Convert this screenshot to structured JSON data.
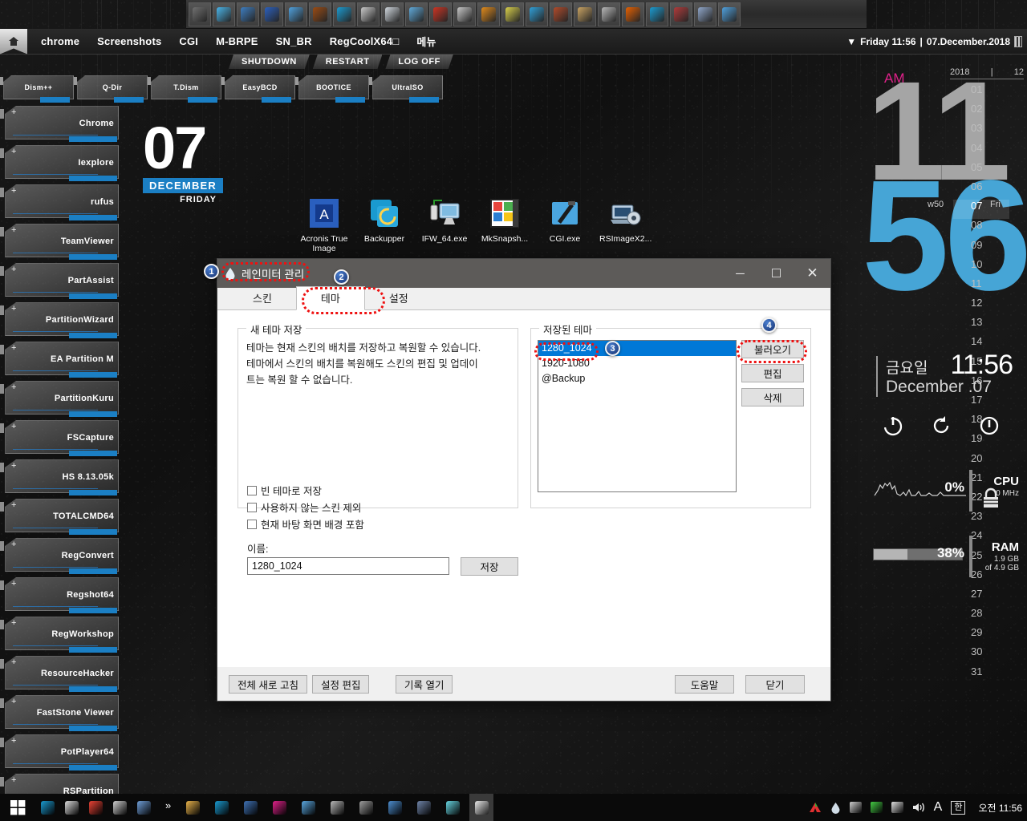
{
  "top_strip": {
    "icons": [
      {
        "name": "windows-logo-icon",
        "color": "#6f6f6f"
      },
      {
        "name": "triangle-app-icon",
        "color": "#49b3e8"
      },
      {
        "name": "blue-doc-icon",
        "color": "#3d7dc0"
      },
      {
        "name": "acronis-a-icon",
        "color": "#2a5fbe"
      },
      {
        "name": "blue-node-icon",
        "color": "#4fa0dd"
      },
      {
        "name": "bridge-br-icon",
        "color": "#9a4a12"
      },
      {
        "name": "backupper-icon",
        "color": "#1a9ad0"
      },
      {
        "name": "drive-icon",
        "color": "#c9c9c9"
      },
      {
        "name": "clock-icon",
        "color": "#cfd6dd"
      },
      {
        "name": "wand-icon",
        "color": "#5fa8d8"
      },
      {
        "name": "g-red-icon",
        "color": "#cc3322"
      },
      {
        "name": "book-icon",
        "color": "#c6c6c6"
      },
      {
        "name": "orange-disc-icon",
        "color": "#e08a1b"
      },
      {
        "name": "scissors-icon",
        "color": "#d8cf4a"
      },
      {
        "name": "gear-icon",
        "color": "#2f9fd8"
      },
      {
        "name": "supra-recorder-icon",
        "color": "#b04a2a"
      },
      {
        "name": "jar-icon",
        "color": "#c8a262"
      },
      {
        "name": "usb-stick-icon",
        "color": "#b8b8b8"
      },
      {
        "name": "firefox-icon",
        "color": "#e66000"
      },
      {
        "name": "edge-icon",
        "color": "#1a9ad0"
      },
      {
        "name": "rs-script-icon",
        "color": "#b03a3a"
      },
      {
        "name": "tower-icon",
        "color": "#8fa5c8"
      },
      {
        "name": "paint-icon",
        "color": "#4fa0dd"
      }
    ]
  },
  "menubar": {
    "home_icon": "home-icon",
    "items": [
      "chrome",
      "Screenshots",
      "CGI",
      "M-BRPE",
      "SN_BR",
      "RegCoolX64□",
      "메뉴"
    ],
    "clock_caret": "▼",
    "clock_text": "Friday 11:56",
    "separator": "|",
    "date_text": "07.December.2018",
    "calendar_icon": "calendar-icon"
  },
  "power_row": [
    "SHUTDOWN",
    "RESTART",
    "LOG OFF"
  ],
  "top_tiles": [
    "Dism++",
    "Q-Dir",
    "T.Dism",
    "EasyBCD",
    "BOOTICE",
    "UltraISO"
  ],
  "side_tiles": [
    "Chrome",
    "Iexplore",
    "rufus",
    "TeamViewer",
    "PartAssist",
    "PartitionWizard",
    "EA Partition M",
    "PartitionKuru",
    "FSCapture",
    "HS 8.13.05k",
    "TOTALCMD64",
    "RegConvert",
    "Regshot64",
    "RegWorkshop",
    "ResourceHacker",
    "FastStone Viewer",
    "PotPlayer64",
    "RSPartition"
  ],
  "date_widget": {
    "day": "07",
    "month": "DECEMBER",
    "weekday": "FRIDAY"
  },
  "desktop_icons": [
    {
      "label": "Acronis True Image",
      "icon": "acronis-true-image-icon"
    },
    {
      "label": "Backupper",
      "icon": "backupper-icon"
    },
    {
      "label": "IFW_64.exe",
      "icon": "ifw64-icon"
    },
    {
      "label": "MkSnapsh...",
      "icon": "mksnapshot-icon"
    },
    {
      "label": "CGI.exe",
      "icon": "cgi-exe-icon"
    },
    {
      "label": "RSImageX2...",
      "icon": "rsimagex2-icon"
    }
  ],
  "right_panel": {
    "ampm": "AM",
    "hour": "11",
    "minute": "56",
    "cal_year": "2018",
    "cal_month": "12",
    "cal_days": [
      "01",
      "02",
      "03",
      "04",
      "05",
      "06",
      "07",
      "08",
      "09",
      "10",
      "11",
      "12",
      "13",
      "14",
      "15",
      "16",
      "17",
      "18",
      "19",
      "20",
      "21",
      "22",
      "23",
      "24",
      "25",
      "26",
      "27",
      "28",
      "29",
      "30",
      "31"
    ],
    "cal_today": "07",
    "cal_today_week": "w50",
    "cal_today_dow": "Fri",
    "day_korean": "금요일",
    "day_english": "December .07",
    "time_hm": "11:56",
    "power_icons": [
      "power-icon",
      "restart-icon",
      "sleep-icon"
    ],
    "lock_icon": "lock-icon",
    "cpu": {
      "pct": "0%",
      "name": "CPU",
      "sub": "0 MHz",
      "icon": "cpu-graph-icon"
    },
    "ram": {
      "pct": "38%",
      "name": "RAM",
      "sub_line1": "1.9 GB",
      "sub_line2": "of 4.9 GB",
      "fill_percent": 38
    }
  },
  "dialog": {
    "title": "레인미터 관리",
    "app_icon": "rainmeter-drop-icon",
    "window_buttons": {
      "minimize": "─",
      "maximize": "☐",
      "close": "✕"
    },
    "tabs": [
      {
        "label": "스킨",
        "active": false
      },
      {
        "label": "테마",
        "active": true
      },
      {
        "label": "설정",
        "active": false
      }
    ],
    "save_group": {
      "caption": "새 테마 저장",
      "description_line1": "테마는 현재 스킨의 배치를 저장하고 복원할 수 있습니다.",
      "description_line2": "테마에서 스킨의 배치를 복원해도 스킨의 편집 및 업데이",
      "description_line3": "트는 복원 할 수 없습니다.",
      "checkboxes": [
        {
          "label": "빈 테마로 저장",
          "checked": false
        },
        {
          "label": "사용하지 않는 스킨 제외",
          "checked": false
        },
        {
          "label": "현재 바탕 화면 배경 포함",
          "checked": false
        }
      ],
      "name_label": "이름:",
      "name_value": "1280_1024",
      "name_placeholder": "",
      "save_button": "저장"
    },
    "themes_group": {
      "caption": "저장된 테마",
      "items": [
        {
          "label": "1280_1024",
          "selected": true
        },
        {
          "label": "1920-1080",
          "selected": false
        },
        {
          "label": "@Backup",
          "selected": false
        }
      ],
      "buttons": [
        "불러오기",
        "편집",
        "삭제"
      ]
    },
    "footer": {
      "left_buttons": [
        "전체 새로 고침",
        "설정 편집",
        "기록 열기"
      ],
      "right_buttons": [
        "도움말",
        "닫기"
      ]
    }
  },
  "annotations": {
    "badges": [
      "1",
      "2",
      "3",
      "4"
    ],
    "accent_ring_color": "#ee1111",
    "badge_color": "#16306e"
  },
  "taskbar": {
    "start_icon": "windows-start-icon",
    "pinned": [
      {
        "name": "backupper-taskbar-icon",
        "color": "#1a9ad0"
      },
      {
        "name": "diamond-taskbar-icon",
        "color": "#dcdcdc"
      },
      {
        "name": "chrome-taskbar-icon",
        "color": "#ea4335"
      },
      {
        "name": "grid-taskbar-icon",
        "color": "#cfcfcf"
      },
      {
        "name": "tool-taskbar-icon",
        "color": "#6f9ed8"
      }
    ],
    "chevron": "»",
    "running": [
      {
        "name": "folder-taskbar-icon",
        "color": "#e8b24a"
      },
      {
        "name": "rainmeter-taskbar-icon",
        "color": "#1a9ad0"
      },
      {
        "name": "window-taskbar-icon",
        "color": "#3f72b5"
      },
      {
        "name": "magenta-taskbar-icon",
        "color": "#e0218a"
      },
      {
        "name": "select-taskbar-icon",
        "color": "#5aa7e0"
      },
      {
        "name": "usb-taskbar-icon",
        "color": "#b8b8b8"
      },
      {
        "name": "drive-taskbar-icon",
        "color": "#9e9e9e"
      },
      {
        "name": "blue-tool-taskbar-icon",
        "color": "#4d8ed0"
      },
      {
        "name": "printer-taskbar-icon",
        "color": "#6f84a8"
      },
      {
        "name": "note-taskbar-icon",
        "color": "#66d4e0"
      },
      {
        "name": "active-window-taskbar-icon",
        "color": "#e8e8e8"
      }
    ],
    "tray": [
      {
        "name": "ahnlab-tray-icon",
        "color": "#e03030"
      },
      {
        "name": "rainmeter-tray-icon",
        "color": "#d0dce6"
      },
      {
        "name": "network-tray-icon",
        "color": "#cfcfcf"
      },
      {
        "name": "color-tray-icon",
        "color": "#44cc44"
      },
      {
        "name": "usb-safely-remove-tray-icon",
        "color": "#e0e0e0"
      },
      {
        "name": "volume-tray-icon",
        "color": "#e8e8e8"
      },
      {
        "name": "font-tray-icon",
        "color": "#e8e8e8"
      },
      {
        "name": "ime-korean-tray-icon",
        "color": "#ffffff"
      }
    ],
    "ime_label": "한",
    "clock_period": "오전",
    "clock_time": "11:56"
  }
}
